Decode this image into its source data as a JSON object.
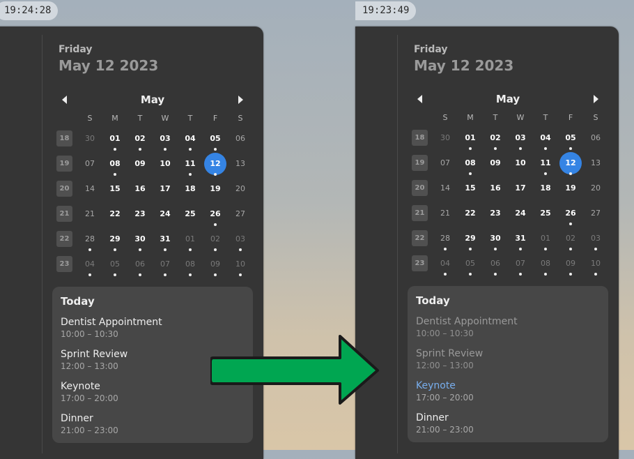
{
  "colors": {
    "accent": "#3584e4",
    "arrow_fill": "#00a651",
    "active_event": "#78aeed"
  },
  "panels": [
    {
      "clock": "19:24:28",
      "weekday": "Friday",
      "date": "May 12 2023",
      "month": "May",
      "day_headers": [
        "S",
        "M",
        "T",
        "W",
        "T",
        "F",
        "S"
      ],
      "weeks": [
        "18",
        "19",
        "20",
        "21",
        "22",
        "23"
      ],
      "events_title": "Today",
      "events": [
        {
          "name": "Dentist Appointment",
          "time": "10:00 – 10:30",
          "state": "normal"
        },
        {
          "name": "Sprint Review",
          "time": "12:00 – 13:00",
          "state": "normal"
        },
        {
          "name": "Keynote",
          "time": "17:00 – 20:00",
          "state": "normal"
        },
        {
          "name": "Dinner",
          "time": "21:00 – 23:00",
          "state": "normal"
        }
      ]
    },
    {
      "clock": "19:23:49",
      "weekday": "Friday",
      "date": "May 12 2023",
      "month": "May",
      "day_headers": [
        "S",
        "M",
        "T",
        "W",
        "T",
        "F",
        "S"
      ],
      "weeks": [
        "18",
        "19",
        "20",
        "21",
        "22",
        "23"
      ],
      "events_title": "Today",
      "events": [
        {
          "name": "Dentist Appointment",
          "time": "10:00 – 10:30",
          "state": "past"
        },
        {
          "name": "Sprint Review",
          "time": "12:00 – 13:00",
          "state": "past"
        },
        {
          "name": "Keynote",
          "time": "17:00 – 20:00",
          "state": "current"
        },
        {
          "name": "Dinner",
          "time": "21:00 – 23:00",
          "state": "normal"
        }
      ]
    }
  ],
  "calendar_rows": [
    [
      {
        "d": "30",
        "t": "other"
      },
      {
        "d": "01",
        "t": "cur",
        "dot": true
      },
      {
        "d": "02",
        "t": "cur",
        "dot": true
      },
      {
        "d": "03",
        "t": "cur",
        "dot": true
      },
      {
        "d": "04",
        "t": "cur",
        "dot": true
      },
      {
        "d": "05",
        "t": "cur",
        "dot": true
      },
      {
        "d": "06",
        "t": "weekend"
      }
    ],
    [
      {
        "d": "07",
        "t": "weekend"
      },
      {
        "d": "08",
        "t": "cur",
        "dot": true
      },
      {
        "d": "09",
        "t": "cur"
      },
      {
        "d": "10",
        "t": "cur"
      },
      {
        "d": "11",
        "t": "cur",
        "dot": true
      },
      {
        "d": "12",
        "t": "today",
        "dot": true
      },
      {
        "d": "13",
        "t": "weekend"
      }
    ],
    [
      {
        "d": "14",
        "t": "weekend"
      },
      {
        "d": "15",
        "t": "cur"
      },
      {
        "d": "16",
        "t": "cur"
      },
      {
        "d": "17",
        "t": "cur"
      },
      {
        "d": "18",
        "t": "cur"
      },
      {
        "d": "19",
        "t": "cur"
      },
      {
        "d": "20",
        "t": "weekend"
      }
    ],
    [
      {
        "d": "21",
        "t": "weekend"
      },
      {
        "d": "22",
        "t": "cur"
      },
      {
        "d": "23",
        "t": "cur"
      },
      {
        "d": "24",
        "t": "cur"
      },
      {
        "d": "25",
        "t": "cur"
      },
      {
        "d": "26",
        "t": "cur",
        "dot": true
      },
      {
        "d": "27",
        "t": "weekend"
      }
    ],
    [
      {
        "d": "28",
        "t": "weekend",
        "dot": true
      },
      {
        "d": "29",
        "t": "cur",
        "dot": true
      },
      {
        "d": "30",
        "t": "cur",
        "dot": true
      },
      {
        "d": "31",
        "t": "cur",
        "dot": true
      },
      {
        "d": "01",
        "t": "other",
        "dot": true
      },
      {
        "d": "02",
        "t": "other",
        "dot": true
      },
      {
        "d": "03",
        "t": "other",
        "dot": true
      }
    ],
    [
      {
        "d": "04",
        "t": "other",
        "dot": true
      },
      {
        "d": "05",
        "t": "other",
        "dot": true
      },
      {
        "d": "06",
        "t": "other",
        "dot": true
      },
      {
        "d": "07",
        "t": "other",
        "dot": true
      },
      {
        "d": "08",
        "t": "other",
        "dot": true
      },
      {
        "d": "09",
        "t": "other",
        "dot": true
      },
      {
        "d": "10",
        "t": "other",
        "dot": true
      }
    ]
  ]
}
